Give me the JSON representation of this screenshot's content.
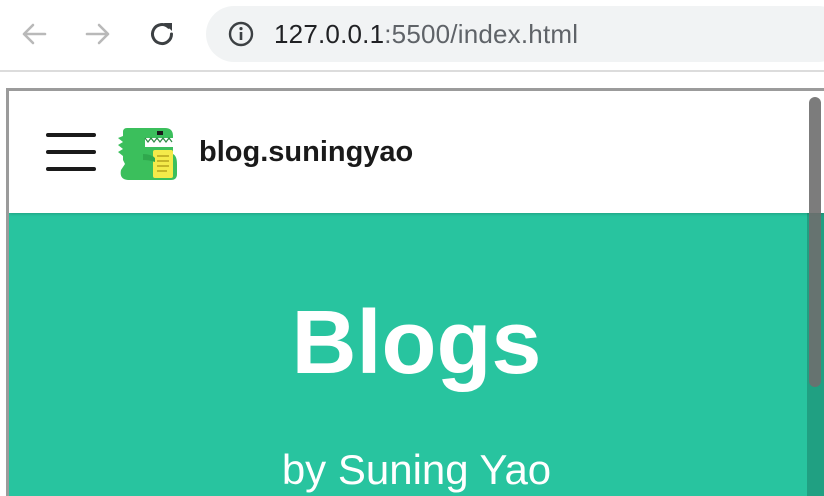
{
  "browser": {
    "url_host": "127.0.0.1",
    "url_rest": ":5500/index.html",
    "icons": {
      "back": "arrow-left-icon",
      "forward": "arrow-right-icon",
      "reload": "reload-icon",
      "site_info": "info-circle-icon"
    }
  },
  "site": {
    "title": "blog.suningyao",
    "logo": "green-dinosaur-logo",
    "menu_icon": "hamburger-menu-icon"
  },
  "hero": {
    "title": "Blogs",
    "subtitle": "by Suning Yao"
  },
  "colors": {
    "accent": "#28c49f",
    "text_dark": "#1a1a1a",
    "omnibox_bg": "#f1f3f4"
  }
}
